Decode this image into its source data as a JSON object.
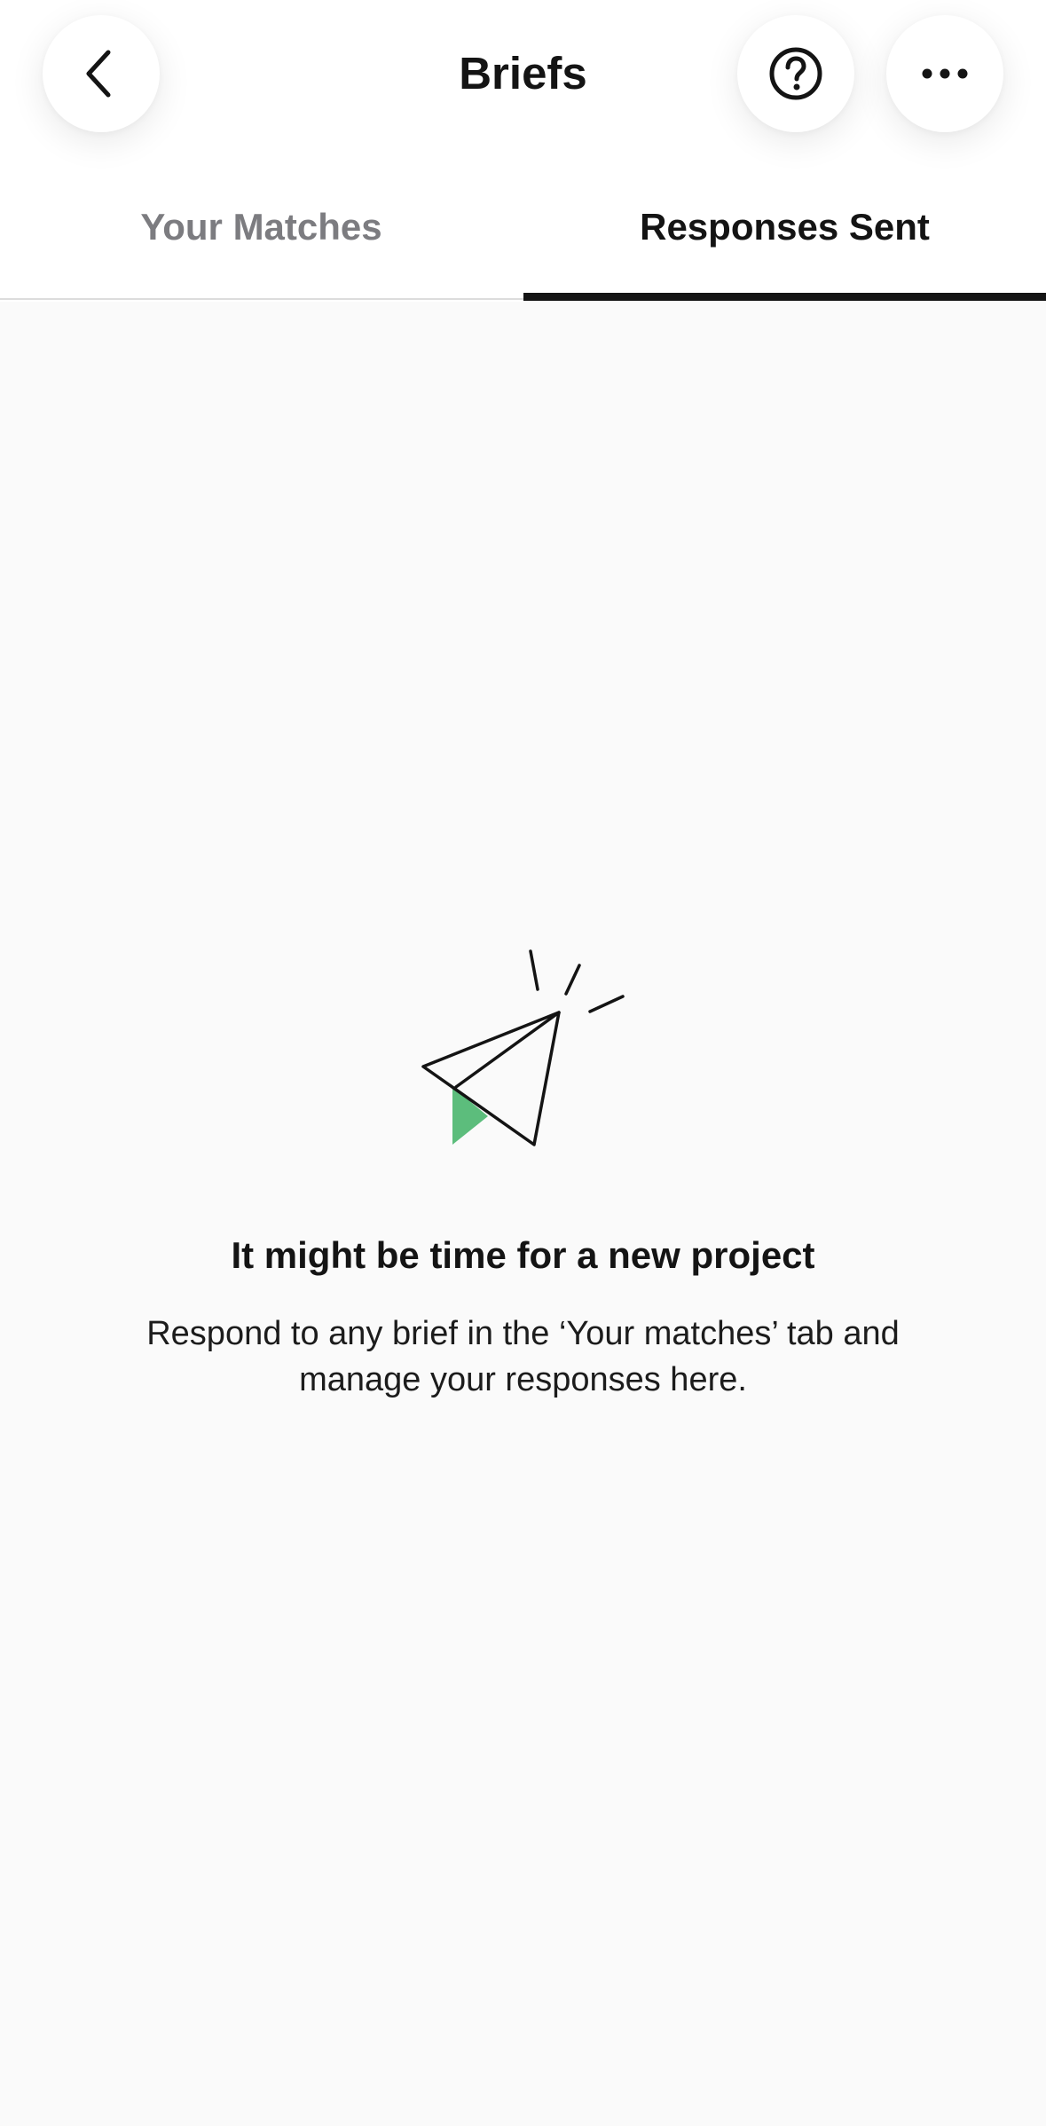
{
  "header": {
    "title": "Briefs",
    "back_icon": "chevron-left-icon",
    "help_icon": "question-circle-icon",
    "more_icon": "more-horizontal-icon"
  },
  "tabs": [
    {
      "label": "Your Matches",
      "active": false
    },
    {
      "label": "Responses Sent",
      "active": true
    }
  ],
  "empty_state": {
    "icon": "paper-plane-icon",
    "title": "It might be time for a new project",
    "description": "Respond to any brief in the ‘Your matches’ tab and manage your responses here."
  },
  "colors": {
    "accent": "#5cbd7c",
    "text": "#141414",
    "inactive_tab": "#7c7c80",
    "background": "#fafafa"
  }
}
